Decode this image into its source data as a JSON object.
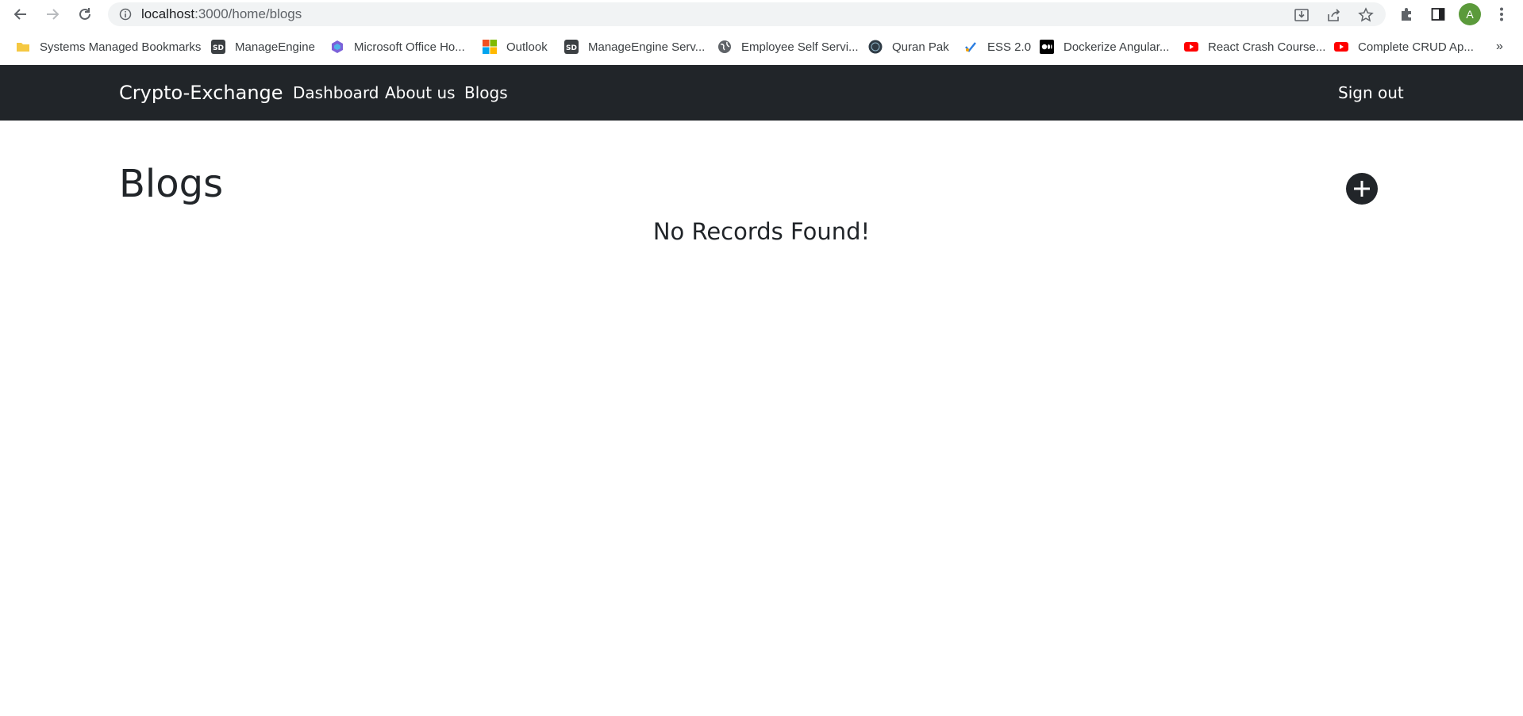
{
  "browser": {
    "url_host": "localhost",
    "url_path": ":3000/home/blogs",
    "profile_initial": "A",
    "bookmarks": [
      {
        "label": "Systems Managed Bookmarks",
        "icon": "folder-icon"
      },
      {
        "label": "ManageEngine",
        "icon": "sd-icon"
      },
      {
        "label": "Microsoft Office Ho...",
        "icon": "office-icon"
      },
      {
        "label": "Outlook",
        "icon": "microsoft-icon"
      },
      {
        "label": "ManageEngine Serv...",
        "icon": "sd-icon"
      },
      {
        "label": "Employee Self Servi...",
        "icon": "globe-icon"
      },
      {
        "label": "Quran Pak",
        "icon": "quran-icon"
      },
      {
        "label": "ESS 2.0",
        "icon": "ess-icon"
      },
      {
        "label": "Dockerize Angular...",
        "icon": "medium-icon"
      },
      {
        "label": "React Crash Course...",
        "icon": "youtube-icon"
      },
      {
        "label": "Complete CRUD Ap...",
        "icon": "youtube-icon"
      }
    ],
    "bookmarks_overflow": "»"
  },
  "navbar": {
    "brand": "Crypto-Exchange",
    "links": [
      "Dashboard",
      "About us",
      "Blogs"
    ],
    "signout": "Sign out"
  },
  "page": {
    "title": "Blogs",
    "empty_message": "No Records Found!"
  },
  "colors": {
    "navbar_bg": "#212529",
    "text": "#212529",
    "avatar": "#5b9a3b"
  }
}
